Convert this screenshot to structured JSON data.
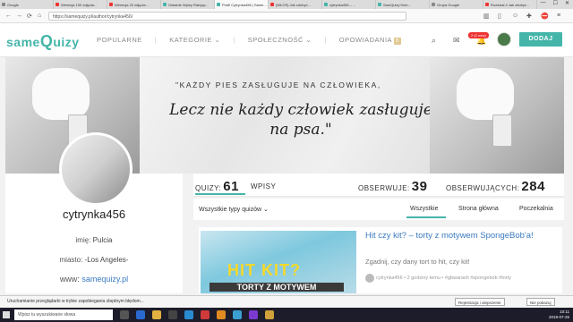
{
  "browser": {
    "tabs": [
      {
        "label": "Google"
      },
      {
        "label": "Wenecja 100 zdjęcia..."
      },
      {
        "label": "Wenecja 20 zdjęcia..."
      },
      {
        "label": "Ostatnie Wpisy Ratując..."
      },
      {
        "label": "Profil Cytrynka456 | Same..."
      },
      {
        "label": "(WŁOS) Jak zdobyć..."
      },
      {
        "label": "cytrynka456 – ..."
      },
      {
        "label": "SamQuizy Klub..."
      },
      {
        "label": "Grupa Google"
      },
      {
        "label": "Rozdział 4 Jak zdobyć..."
      }
    ],
    "active_tab": 4,
    "url": "https://samequizy.pl/author/cytrynka456/"
  },
  "site": {
    "logo_same": "same",
    "logo_q": "Q",
    "logo_uizy": "uizy",
    "menu": [
      "POPULARNE",
      "KATEGORIE",
      "SPOŁECZNOŚĆ",
      "OPOWIADANIA"
    ],
    "menu_badge": "B",
    "notif_count": "2 (2 new)",
    "dodaj_label": "DODAJ",
    "icons": [
      "search-icon",
      "mail-icon",
      "bell-icon"
    ]
  },
  "banner": {
    "quote_line1": "\"KAŻDY PIES ZASŁUGUJE NA CZŁOWIEKA,",
    "quote_line2": "Lecz nie każdy człowiek zasługuje na psa.\""
  },
  "profile": {
    "username": "cytrynka456",
    "imie_label": "imię:",
    "imie_value": "Pulcia",
    "miasto_label": "miasto:",
    "miasto_value": "-Los Angeles-",
    "www_label": "www:",
    "www_value": "samequizy.pl"
  },
  "stats": {
    "quizy_label": "QUIZY:",
    "quizy_value": "61",
    "wpisy_label": "WPISY",
    "obserwuje_label": "OBSERWUJE:",
    "obserwuje_value": "39",
    "obserwujacych_label": "OBSERWUJĄCYCH:",
    "obserwujacych_value": "284"
  },
  "filters": {
    "type_select": "Wszystkie typy quizów",
    "tabs": [
      "Wszystkie",
      "Strona główna",
      "Poczekalnia"
    ],
    "active": 0
  },
  "quiz_card": {
    "title": "Hit czy kit? – torty z motywem SpongeBob'a!",
    "desc": "Zgadnij, czy dany tort to hit, czy kit!",
    "meta": "cytrynka456 • 2 godziny temu • #gbwarash #spongebob #torty",
    "thumb_hit": "HIT KIT?",
    "thumb_torty": "TORTY Z MOTYWEM"
  },
  "download_bar": {
    "text": "Uruchamianie przeglądarki w trybie zapobiegania zbędnym błędom...",
    "btn1": "Rejestracja i ulepszenie",
    "btn2": "Nie pokazuj"
  },
  "taskbar": {
    "search_placeholder": "Wpisz tu wyszukiwane słowa",
    "time": "10:11",
    "date": "2019-07-26"
  }
}
